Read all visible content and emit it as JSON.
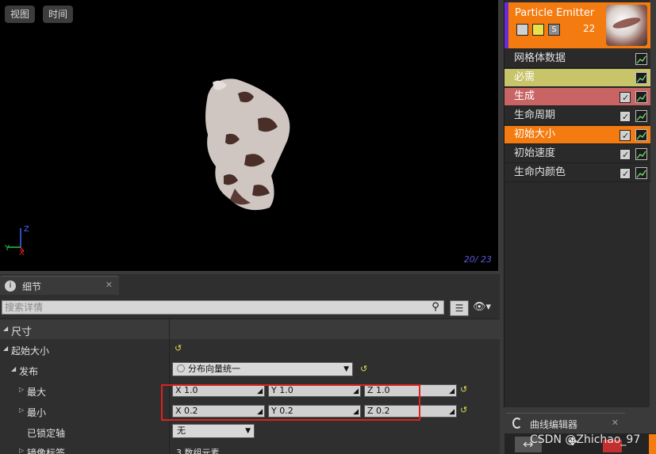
{
  "viewport": {
    "view_button": "视图",
    "time_button": "时间",
    "counter": "20/ 23"
  },
  "emitter": {
    "title": "Particle Emitter",
    "count": "22",
    "solo_label": "S",
    "modules": [
      {
        "label": "网格体数据",
        "color": "#2a2a2a",
        "text_color": "#e0e0e0",
        "has_checkbox": false
      },
      {
        "label": "必需",
        "color": "#c8c46a",
        "text_color": "#ffffff",
        "has_checkbox": false
      },
      {
        "label": "生成",
        "color": "#c86464",
        "text_color": "#ffffff",
        "has_checkbox": true
      },
      {
        "label": "生命周期",
        "color": "#2a2a2a",
        "text_color": "#e0e0e0",
        "has_checkbox": true
      },
      {
        "label": "初始大小",
        "color": "#f47b10",
        "text_color": "#ffffff",
        "has_checkbox": true
      },
      {
        "label": "初始速度",
        "color": "#2a2a2a",
        "text_color": "#e0e0e0",
        "has_checkbox": true
      },
      {
        "label": "生命内颜色",
        "color": "#2a2a2a",
        "text_color": "#e0e0e0",
        "has_checkbox": true
      }
    ]
  },
  "details": {
    "tab_label": "细节",
    "search_placeholder": "搜索详情",
    "section_title": "尺寸",
    "start_size_label": "起始大小",
    "distribution_label": "发布",
    "distribution_value": "分布向量统一",
    "max_label": "最大",
    "min_label": "最小",
    "locked_axis_label": "已锁定轴",
    "locked_axis_value": "无",
    "mirror_label": "镜像标签",
    "mirror_value": "3 数组元素",
    "max": {
      "x": "X  1.0",
      "y": "Y  1.0",
      "z": "Z  1.0"
    },
    "min": {
      "x": "X  0.2",
      "y": "Y  0.2",
      "z": "Z  0.2"
    }
  },
  "curve_editor": {
    "tab_label": "曲线编辑器"
  },
  "watermark": "CSDN @Zhichao_97",
  "colors": {
    "accent_orange": "#f47b10",
    "emitter_purple": "#6a2cd6",
    "highlight_red": "#e02020",
    "viewport_bg": "#000000"
  }
}
